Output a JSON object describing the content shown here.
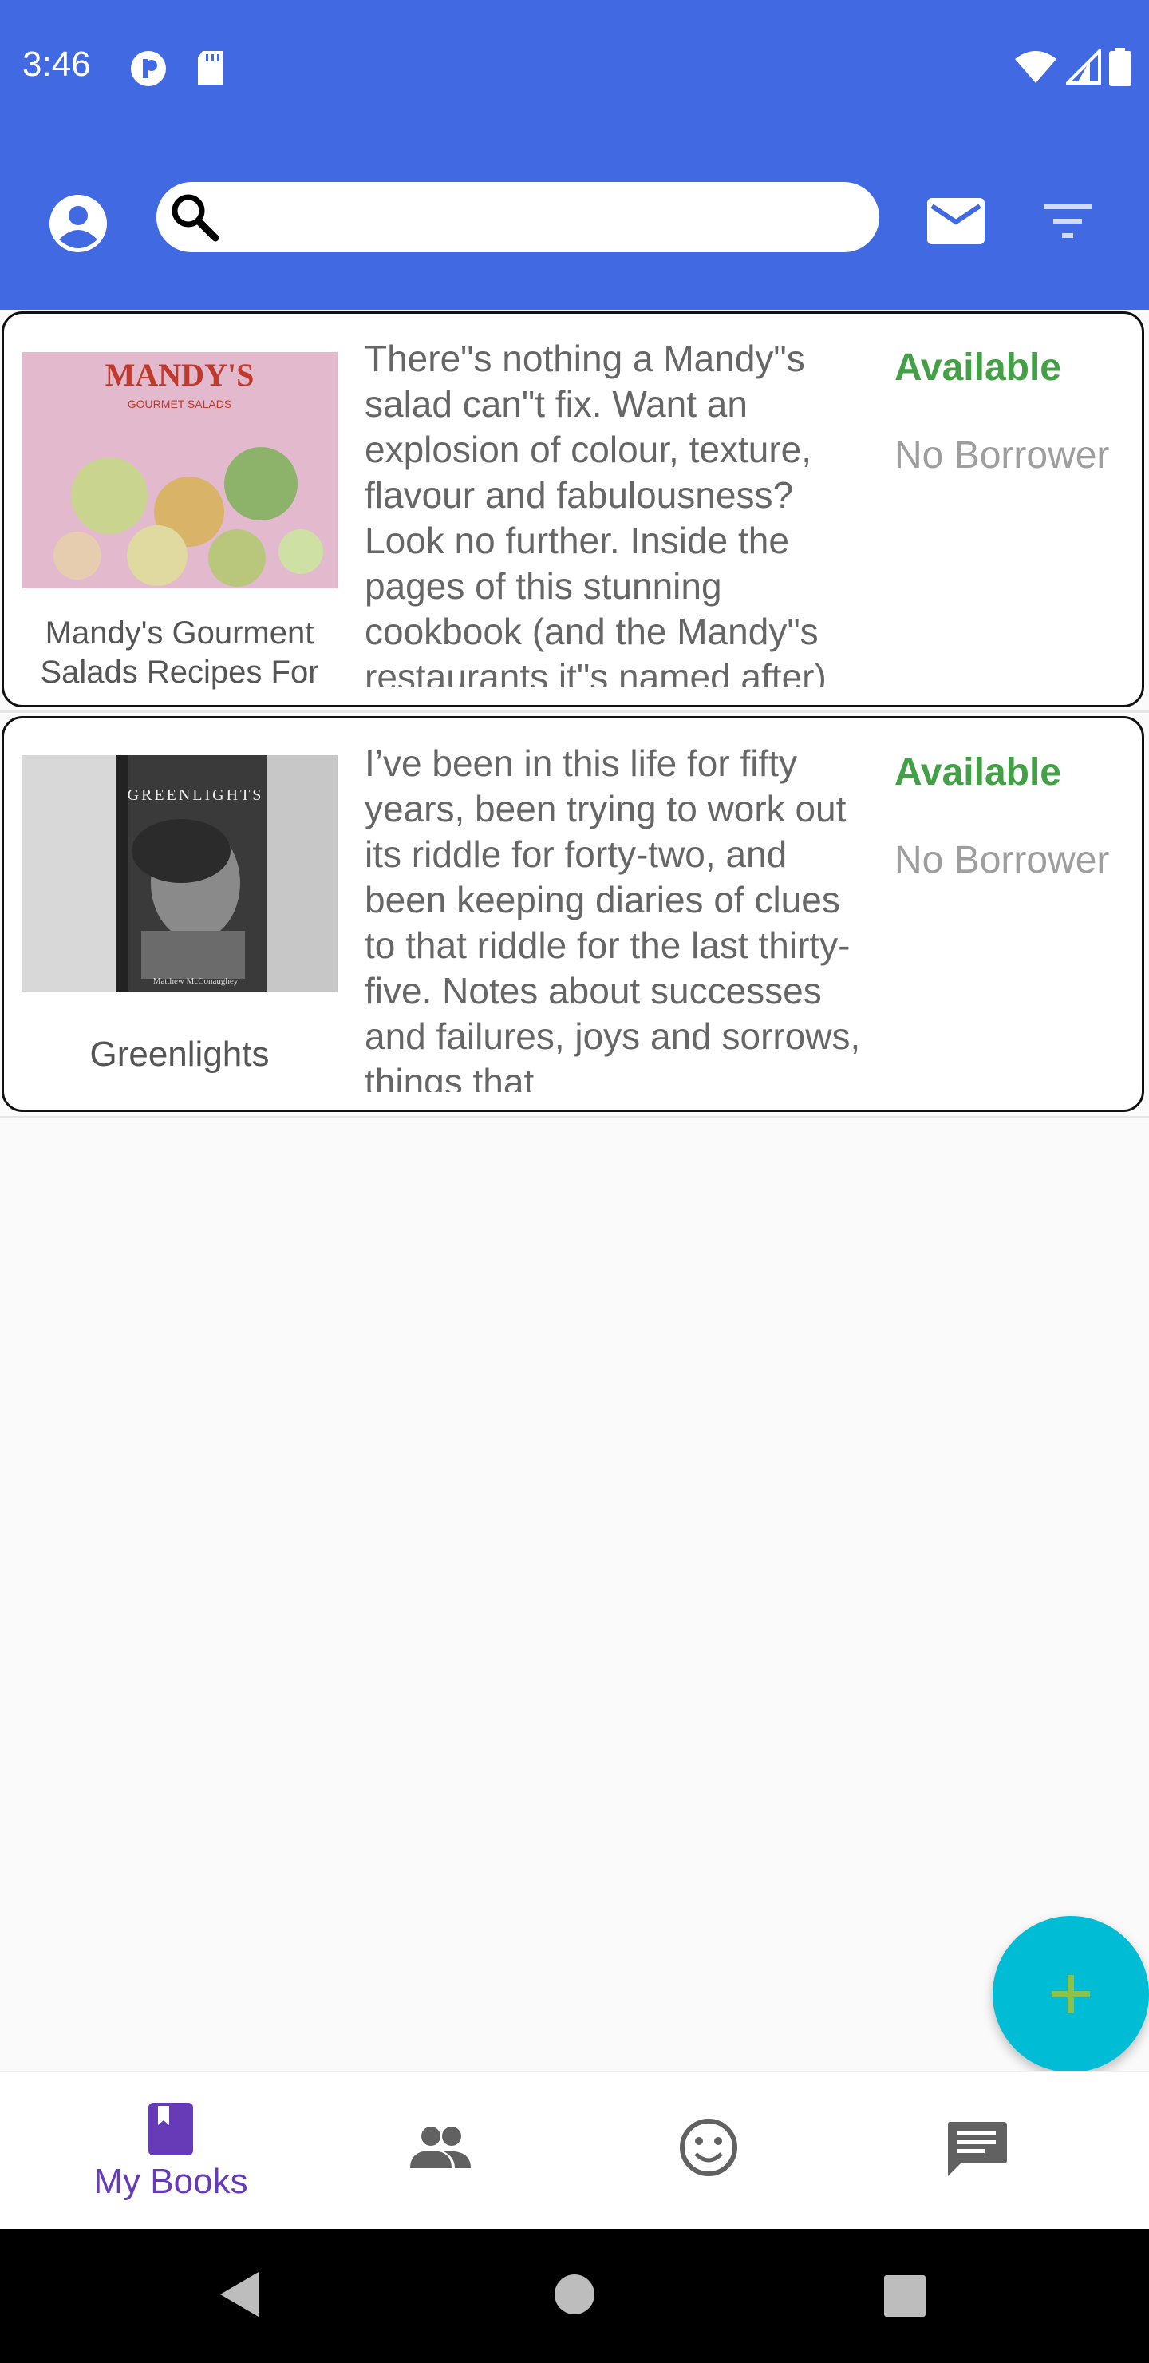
{
  "status_bar": {
    "time": "3:46"
  },
  "search": {
    "value": "",
    "placeholder": ""
  },
  "books": [
    {
      "title": "Mandy's Gourment Salads Recipes For",
      "cover_text": "MANDY'S",
      "cover_subtext": "GOURMET SALADS",
      "description": "There\"s nothing a Mandy\"s salad can\"t fix. Want an explosion of colour, texture, flavour and fabulousness? Look no further. Inside the pages of this stunning cookbook (and the Mandy\"s restaurants it\"s named after)",
      "status": "Available",
      "borrower": "No Borrower"
    },
    {
      "title": "Greenlights",
      "cover_text": "GREENLIGHTS",
      "cover_subtext": "Matthew McConaughey",
      "description": "I’ve been in this life for fifty years, been trying to work out its riddle for forty-two, and been keeping diaries of clues to that riddle for the last thirty-five. Notes about successes and failures, joys and sorrows, things that",
      "status": "Available",
      "borrower": "No Borrower"
    }
  ],
  "bottom_nav": {
    "items": [
      {
        "icon": "book-icon",
        "label": "My Books",
        "active": true
      },
      {
        "icon": "people-icon",
        "label": "",
        "active": false
      },
      {
        "icon": "smiley-icon",
        "label": "",
        "active": false
      },
      {
        "icon": "chat-icon",
        "label": "",
        "active": false
      }
    ]
  },
  "colors": {
    "app_bar": "#4169e1",
    "available": "#43a047",
    "fab": "#00bcd4",
    "nav_active": "#673ab7"
  }
}
